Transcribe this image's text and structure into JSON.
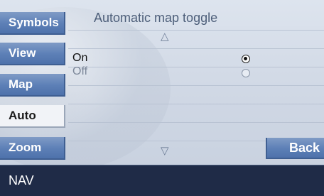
{
  "sidebar": {
    "items": [
      {
        "label": "Symbols",
        "selected": false
      },
      {
        "label": "View",
        "selected": false
      },
      {
        "label": "Map",
        "selected": false
      },
      {
        "label": "Auto",
        "selected": true
      },
      {
        "label": "Zoom",
        "selected": false
      }
    ]
  },
  "main": {
    "title": "Automatic map toggle",
    "scroll_up_icon": "triangle-up-icon",
    "scroll_down_icon": "triangle-down-icon",
    "options": [
      {
        "label": "On",
        "checked": true
      },
      {
        "label": "Off",
        "checked": false
      }
    ]
  },
  "back_button": {
    "label": "Back"
  },
  "status_bar": {
    "label": "NAV"
  },
  "colors": {
    "accent": "#5c7fb6",
    "status_bar": "#1f2b47",
    "panel": "#d3dae6"
  }
}
